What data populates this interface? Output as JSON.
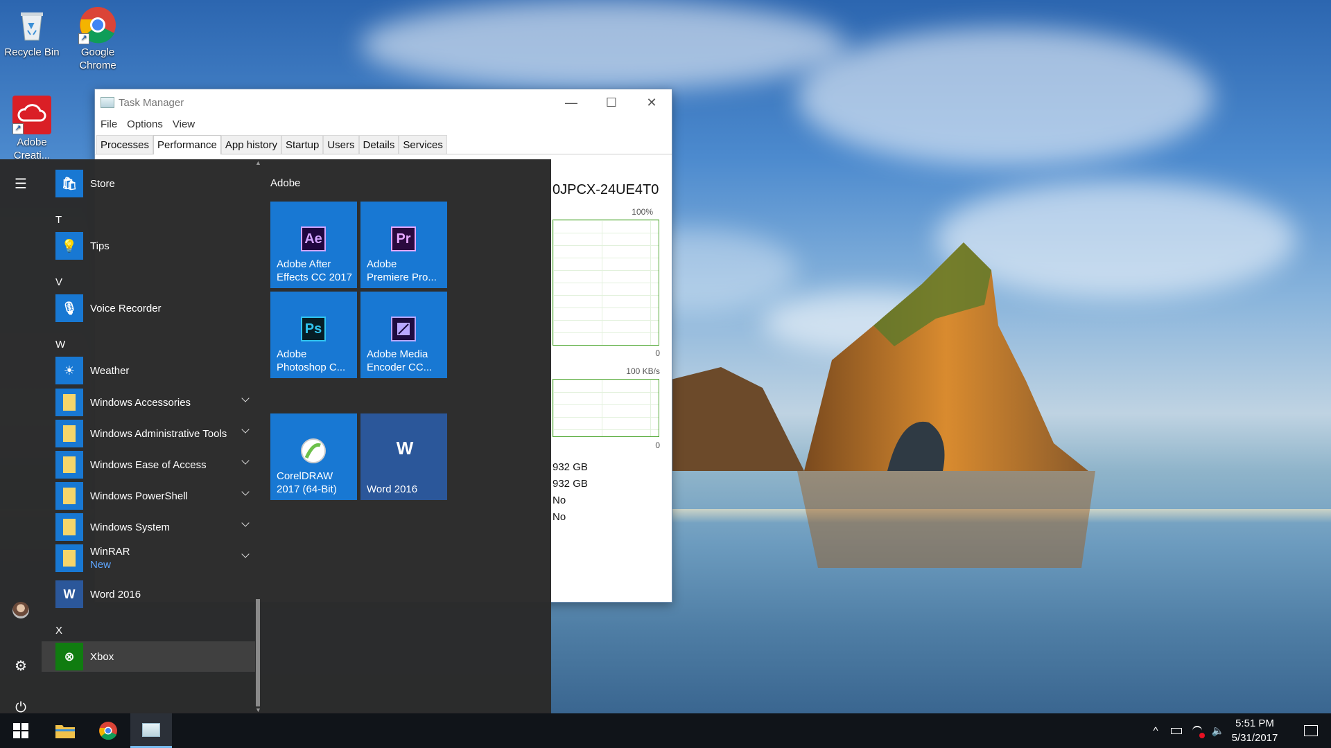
{
  "desktop": {
    "icons": [
      {
        "label_lines": [
          "Recycle Bin"
        ],
        "icon": "recycle-bin-icon"
      },
      {
        "label_lines": [
          "Google",
          "Chrome"
        ],
        "icon": "chrome-icon"
      },
      {
        "label_lines": [
          "Adobe",
          "Creati..."
        ],
        "icon": "creative-cloud-icon"
      }
    ]
  },
  "task_manager": {
    "title": "Task Manager",
    "window_controls": {
      "minimize": "—",
      "maximize": "☐",
      "close": "✕"
    },
    "menu": [
      "File",
      "Options",
      "View"
    ],
    "tabs": [
      "Processes",
      "Performance",
      "App history",
      "Startup",
      "Users",
      "Details",
      "Services"
    ],
    "active_tab": "Performance",
    "disk_name_fragment": "0JPCX-24UE4T0",
    "graph1": {
      "top_label": "100%",
      "bottom_label": "0"
    },
    "graph2": {
      "top_label": "100 KB/s",
      "bottom_label": "0"
    },
    "stats": [
      "932 GB",
      "932 GB",
      "No",
      "No"
    ]
  },
  "start_menu": {
    "rail": {
      "menu": "☰",
      "settings": "⚙",
      "power": "⏻"
    },
    "apps": [
      {
        "type": "app",
        "label": "Store",
        "icon": "store-icon",
        "color": "#1878d3"
      },
      {
        "type": "letter",
        "label": "T"
      },
      {
        "type": "app",
        "label": "Tips",
        "icon": "lightbulb-icon",
        "color": "#1878d3"
      },
      {
        "type": "letter",
        "label": "V"
      },
      {
        "type": "app",
        "label": "Voice Recorder",
        "icon": "microphone-icon",
        "color": "#1878d3"
      },
      {
        "type": "letter",
        "label": "W"
      },
      {
        "type": "app",
        "label": "Weather",
        "icon": "sun-icon",
        "color": "#1878d3"
      },
      {
        "type": "folder",
        "label": "Windows Accessories"
      },
      {
        "type": "folder",
        "label": "Windows Administrative Tools"
      },
      {
        "type": "folder",
        "label": "Windows Ease of Access"
      },
      {
        "type": "folder",
        "label": "Windows PowerShell"
      },
      {
        "type": "folder",
        "label": "Windows System"
      },
      {
        "type": "folder",
        "label": "WinRAR",
        "sublabel": "New"
      },
      {
        "type": "app",
        "label": "Word 2016",
        "icon": "word-icon",
        "color": "#2b579a"
      },
      {
        "type": "letter",
        "label": "X"
      },
      {
        "type": "app",
        "label": "Xbox",
        "icon": "xbox-icon",
        "color": "#107c10",
        "highlighted": true
      }
    ],
    "tile_group": "Adobe",
    "tiles": [
      {
        "label_lines": [
          "Adobe After",
          "Effects CC 2017"
        ],
        "glyph": "Ae",
        "icon": "after-effects-icon",
        "glyph_color": "#d2a4ff",
        "icon_bg": "#1f0740"
      },
      {
        "label_lines": [
          "Adobe",
          "Premiere Pro..."
        ],
        "glyph": "Pr",
        "icon": "premiere-pro-icon",
        "glyph_color": "#e6a7ff",
        "icon_bg": "#2a0a3e"
      },
      {
        "label_lines": [
          "Adobe",
          "Photoshop C..."
        ],
        "glyph": "Ps",
        "icon": "photoshop-icon",
        "glyph_color": "#31c5f0",
        "icon_bg": "#061e26"
      },
      {
        "label_lines": [
          "Adobe Media",
          "Encoder CC..."
        ],
        "glyph": "",
        "icon": "media-encoder-icon",
        "glyph_color": "#b9a7ff",
        "icon_bg": "#1e0c40"
      },
      {
        "label_lines": [
          "CorelDRAW",
          "2017 (64-Bit)"
        ],
        "glyph": "",
        "icon": "coreldraw-icon",
        "glyph_color": "#6cc04a",
        "icon_bg": "#ffffff"
      },
      {
        "label_lines": [
          "Word 2016"
        ],
        "glyph": "W",
        "icon": "word-tile-icon",
        "glyph_color": "#ffffff",
        "icon_bg": "#2b579a"
      }
    ]
  },
  "taskbar": {
    "tray": {
      "chevron": "^",
      "time": "5:51 PM",
      "date": "5/31/2017"
    }
  }
}
